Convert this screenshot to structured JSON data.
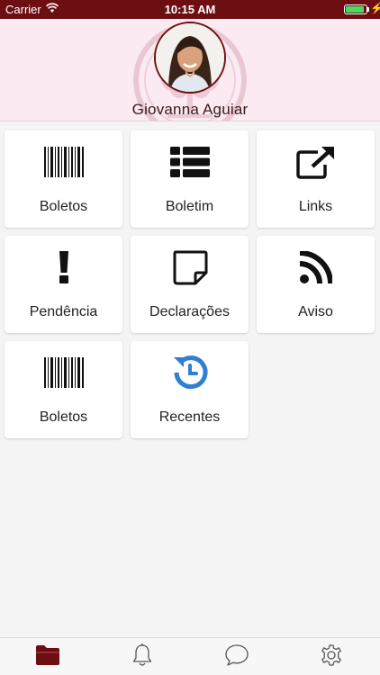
{
  "status_bar": {
    "carrier": "Carrier",
    "time": "10:15 AM",
    "battery_level": 0.9
  },
  "header": {
    "user_name": "Giovanna Aguiar"
  },
  "tiles": [
    {
      "label": "Boletos",
      "icon": "barcode-icon"
    },
    {
      "label": "Boletim",
      "icon": "list-icon"
    },
    {
      "label": "Links",
      "icon": "external-link-icon"
    },
    {
      "label": "Pendência",
      "icon": "exclamation-icon"
    },
    {
      "label": "Declarações",
      "icon": "sticky-note-icon"
    },
    {
      "label": "Aviso",
      "icon": "rss-icon"
    },
    {
      "label": "Boletos",
      "icon": "barcode-icon"
    },
    {
      "label": "Recentes",
      "icon": "history-icon"
    }
  ],
  "tab_bar": {
    "tabs": [
      "folder-icon",
      "bell-icon",
      "chat-icon",
      "settings-icon"
    ],
    "active_index": 0
  },
  "colors": {
    "brand": "#6d0f12",
    "header_bg": "#fbeaf1",
    "accent_blue": "#2f7fd4",
    "battery": "#4cd964"
  }
}
